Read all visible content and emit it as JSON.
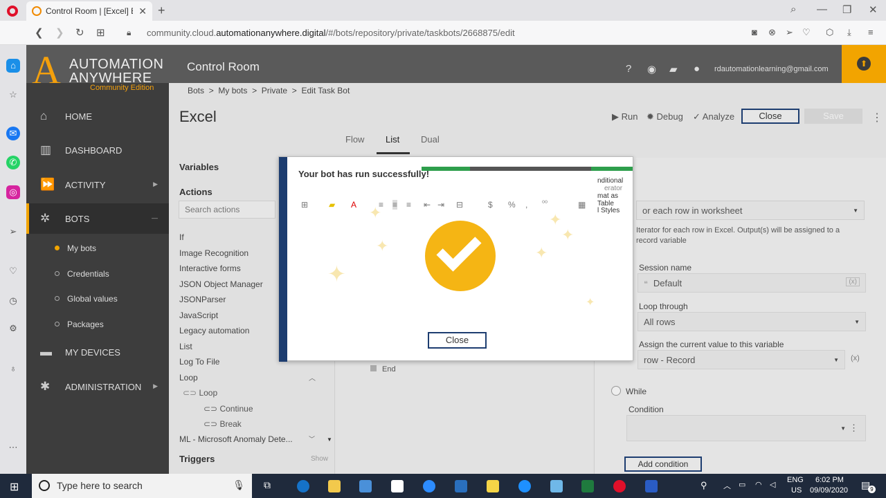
{
  "browser": {
    "tab_title": "Control Room | [Excel] Edit",
    "url_prefix": "community.cloud.",
    "url_domain": "automationanywhere.digital",
    "url_path": "/#/bots/repository/private/taskbots/2668875/edit"
  },
  "header": {
    "logo_line1": "AUTOMATION",
    "logo_line2": "ANYWHERE",
    "logo_line3": "Community Edition",
    "title": "Control Room",
    "user_email": "rdautomationlearning@gmail.com"
  },
  "nav": {
    "home": "HOME",
    "dashboard": "DASHBOARD",
    "activity": "ACTIVITY",
    "bots": "BOTS",
    "my_bots": "My bots",
    "credentials": "Credentials",
    "global_values": "Global values",
    "packages": "Packages",
    "my_devices": "MY DEVICES",
    "administration": "ADMINISTRATION"
  },
  "breadcrumb": {
    "b1": "Bots",
    "b2": "My bots",
    "b3": "Private",
    "b4": "Edit Task Bot",
    "sep": ">"
  },
  "editor": {
    "bot_name": "Excel",
    "run": "Run",
    "debug": "Debug",
    "analyze": "Analyze",
    "close": "Close",
    "save": "Save",
    "tabs": {
      "flow": "Flow",
      "list": "List",
      "dual": "Dual"
    },
    "variables": "Variables",
    "actions": "Actions",
    "search_placeholder": "Search actions",
    "action_items": [
      "If",
      "Image Recognition",
      "Interactive forms",
      "JSON Object Manager",
      "JSONParser",
      "JavaScript",
      "Legacy automation",
      "List",
      "Log To File",
      "Loop"
    ],
    "loop_sub": "Loop",
    "continue": "Continue",
    "break": "Break",
    "ml": "ML - Microsoft Anomaly Dete...",
    "triggers": "Triggers",
    "show": "Show",
    "end": "End"
  },
  "props": {
    "iterator": "or each row in worksheet",
    "iterator_desc1": "Iterator for each row in Excel. Output(s) will be assigned to a",
    "iterator_desc2": "record variable",
    "session_label": "Session name",
    "session_value": "Default",
    "loop_label": "Loop through",
    "loop_value": "All rows",
    "assign_label": "Assign the current value to this variable",
    "assign_value": "row - Record",
    "while": "While",
    "condition": "Condition",
    "add_condition": "Add condition"
  },
  "modal": {
    "title": "Your bot has run successfully!",
    "close": "Close",
    "bg_text1": "nditional",
    "bg_text2": "mat as Table",
    "bg_text3": "l Styles",
    "bg_text4": "erator"
  },
  "taskbar": {
    "search": "Type here to search",
    "lang1": "ENG",
    "lang2": "US",
    "time": "6:02 PM",
    "date": "09/09/2020",
    "notif": "9"
  },
  "colors": {
    "accent": "#f2a400",
    "nav_bg": "#3d3d3d",
    "modal_strip": "#1d3d70"
  }
}
